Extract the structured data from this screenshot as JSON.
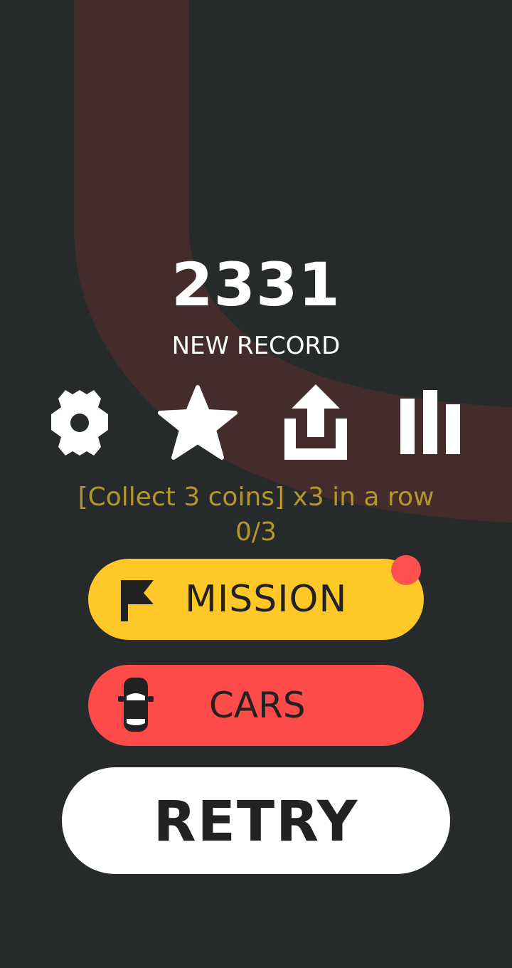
{
  "game": {
    "score": "2331",
    "record_label": "NEW RECORD"
  },
  "toolbar": {
    "settings_icon": "gear-icon",
    "rate_icon": "star-icon",
    "share_icon": "share-icon",
    "leaderboard_icon": "bar-chart-icon"
  },
  "mission": {
    "description": "[Collect 3 coins] x3 in a row",
    "progress": "0/3"
  },
  "buttons": {
    "mission_label": "MISSION",
    "mission_icon": "flag-icon",
    "cars_label": "CARS",
    "cars_icon": "car-icon",
    "retry_label": "RETRY"
  },
  "colors": {
    "background": "#262a2b",
    "road": "#432c2b",
    "mission_button": "#ffc727",
    "cars_button": "#ff4a4a",
    "retry_button": "#ffffff",
    "mission_text": "#b3962e",
    "notification_dot": "#ff4f4f"
  }
}
